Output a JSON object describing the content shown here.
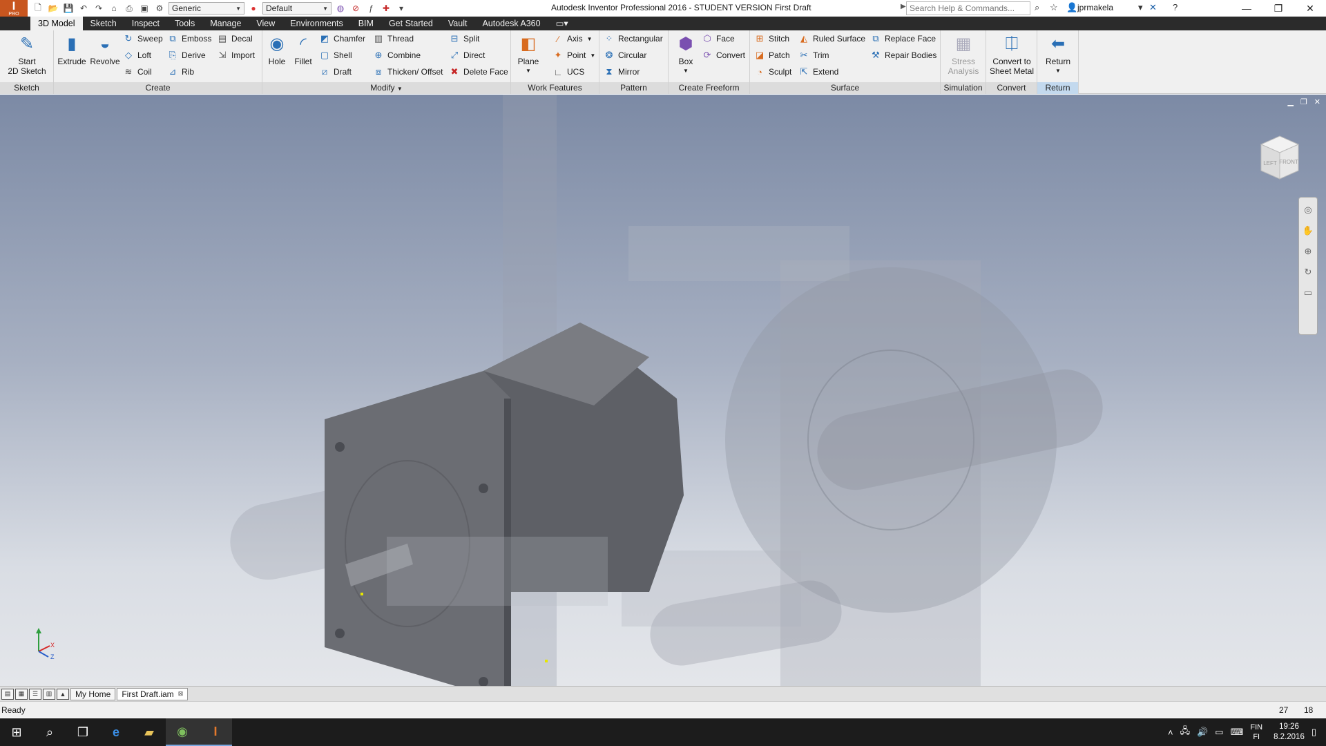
{
  "titlebar": {
    "app_label": "I",
    "app_sub": "PRO",
    "style_dropdown": "Generic",
    "appearance_dropdown": "Default",
    "window_title": "Autodesk Inventor Professional 2016 - STUDENT VERSION   First Draft",
    "search_placeholder": "Search Help & Commands...",
    "user": "jprmakela"
  },
  "tabs": [
    "3D Model",
    "Sketch",
    "Inspect",
    "Tools",
    "Manage",
    "View",
    "Environments",
    "BIM",
    "Get Started",
    "Vault",
    "Autodesk A360"
  ],
  "ribbon": {
    "sketch": {
      "label": "Sketch",
      "start": "Start\n2D Sketch"
    },
    "create": {
      "label": "Create",
      "extrude": "Extrude",
      "revolve": "Revolve",
      "sweep": "Sweep",
      "loft": "Loft",
      "coil": "Coil",
      "emboss": "Emboss",
      "derive": "Derive",
      "rib": "Rib",
      "decal": "Decal",
      "import": "Import"
    },
    "modify": {
      "label": "Modify",
      "hole": "Hole",
      "fillet": "Fillet",
      "chamfer": "Chamfer",
      "shell": "Shell",
      "draft": "Draft",
      "thread": "Thread",
      "combine": "Combine",
      "thicken": "Thicken/ Offset",
      "split": "Split",
      "direct": "Direct",
      "delete_face": "Delete Face"
    },
    "work": {
      "label": "Work Features",
      "plane": "Plane",
      "axis": "Axis",
      "point": "Point",
      "ucs": "UCS"
    },
    "pattern": {
      "label": "Pattern",
      "rectangular": "Rectangular",
      "circular": "Circular",
      "mirror": "Mirror"
    },
    "freeform": {
      "label": "Create Freeform",
      "box": "Box",
      "face": "Face",
      "convert": "Convert"
    },
    "surface": {
      "label": "Surface",
      "stitch": "Stitch",
      "patch": "Patch",
      "sculpt": "Sculpt",
      "ruled": "Ruled Surface",
      "trim": "Trim",
      "extend": "Extend",
      "replace_face": "Replace Face",
      "repair": "Repair Bodies"
    },
    "simulation": {
      "label": "Simulation",
      "stress": "Stress\nAnalysis"
    },
    "convert": {
      "label": "Convert",
      "sheet_metal": "Convert to\nSheet Metal"
    },
    "return": {
      "label": "Return",
      "return": "Return"
    }
  },
  "viewcube": {
    "left": "LEFT",
    "front": "FRONT"
  },
  "triad": {
    "x": "X",
    "y": "Y",
    "z": "Z"
  },
  "doctabs": {
    "home": "My Home",
    "file": "First Draft.iam"
  },
  "status": {
    "text": "Ready",
    "n1": "27",
    "n2": "18"
  },
  "taskbar": {
    "lang_top": "FIN",
    "lang_bottom": "FI",
    "time": "19:26",
    "date": "8.2.2016"
  }
}
